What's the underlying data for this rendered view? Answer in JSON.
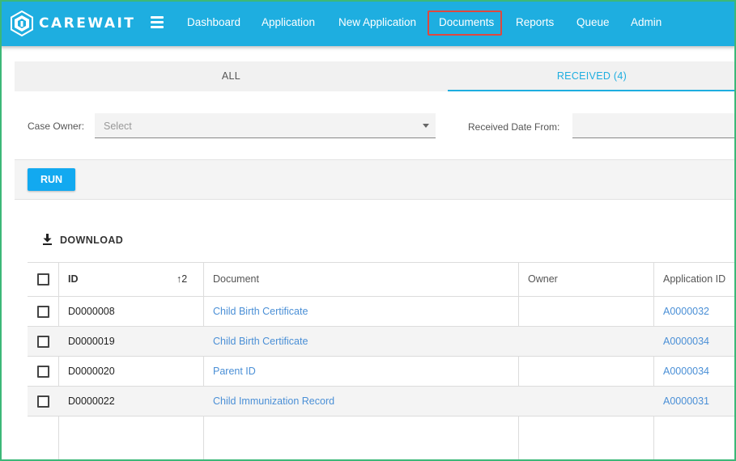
{
  "app": {
    "brand": "CAREWAIT"
  },
  "nav": {
    "items": [
      "Dashboard",
      "Application",
      "New Application",
      "Documents",
      "Reports",
      "Queue",
      "Admin"
    ],
    "active": "Documents"
  },
  "tabs": {
    "all": "ALL",
    "received": "RECEIVED (4)"
  },
  "filters": {
    "case_owner_label": "Case Owner:",
    "case_owner_placeholder": "Select",
    "received_date_from_label": "Received Date From:"
  },
  "actions": {
    "run_label": "RUN",
    "download_label": "DOWNLOAD"
  },
  "table": {
    "columns": {
      "id": "ID",
      "document": "Document",
      "owner": "Owner",
      "application_id": "Application ID"
    },
    "sort": {
      "column": "ID",
      "direction": "ascending",
      "priority": "2",
      "arrow": "↑"
    },
    "rows": [
      {
        "id": "D0000008",
        "document": "Child Birth Certificate",
        "owner": "",
        "application_id": "A0000032"
      },
      {
        "id": "D0000019",
        "document": "Child Birth Certificate",
        "owner": "",
        "application_id": "A0000034"
      },
      {
        "id": "D0000020",
        "document": "Parent ID",
        "owner": "",
        "application_id": "A0000034"
      },
      {
        "id": "D0000022",
        "document": "Child Immunization Record",
        "owner": "",
        "application_id": "A0000031"
      }
    ]
  },
  "colors": {
    "header_bg": "#1eaee0",
    "accent": "#1eaee0",
    "run_button": "#12a9f0",
    "link": "#4a8fd6",
    "highlight_box": "#e0473e",
    "frame_border": "#3cb878"
  },
  "icons": {
    "logo": "carewait-cube-logo",
    "menu": "hamburger-icon",
    "download": "download-icon",
    "sort": "sort-arrow-up-icon"
  }
}
